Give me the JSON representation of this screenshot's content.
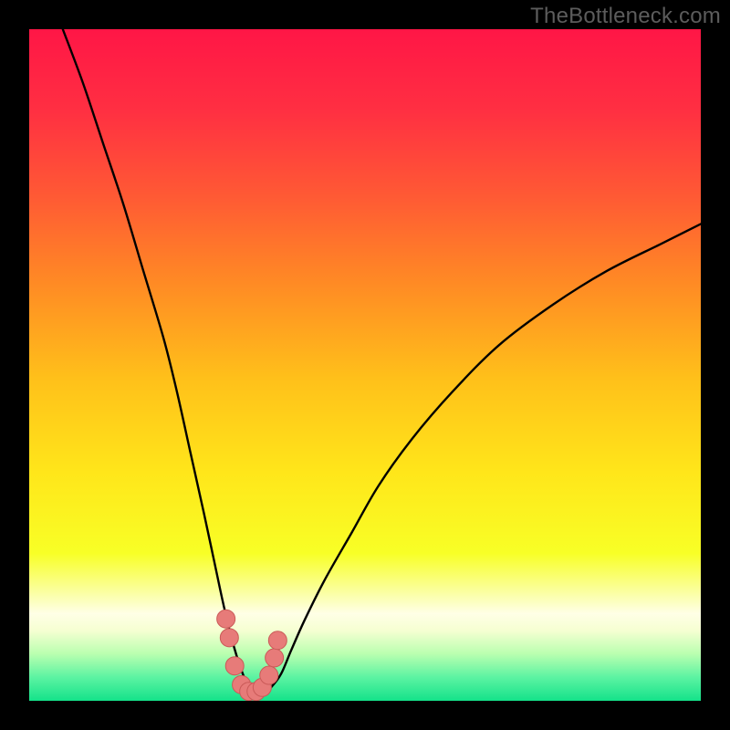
{
  "watermark": {
    "text": "TheBottleneck.com"
  },
  "colors": {
    "frame": "#000000",
    "curve": "#000000",
    "marker_fill": "#e77b79",
    "marker_stroke": "#ca5a58",
    "gradient_stops": [
      {
        "offset": 0.0,
        "color": "#ff1646"
      },
      {
        "offset": 0.12,
        "color": "#ff2f42"
      },
      {
        "offset": 0.25,
        "color": "#ff5a34"
      },
      {
        "offset": 0.38,
        "color": "#ff8b24"
      },
      {
        "offset": 0.52,
        "color": "#ffc01a"
      },
      {
        "offset": 0.66,
        "color": "#ffe61a"
      },
      {
        "offset": 0.78,
        "color": "#f8ff26"
      },
      {
        "offset": 0.845,
        "color": "#fbffb0"
      },
      {
        "offset": 0.87,
        "color": "#ffffe6"
      },
      {
        "offset": 0.895,
        "color": "#f6ffd2"
      },
      {
        "offset": 0.93,
        "color": "#baffb0"
      },
      {
        "offset": 0.965,
        "color": "#5cf3a2"
      },
      {
        "offset": 1.0,
        "color": "#14e28a"
      }
    ]
  },
  "chart_data": {
    "type": "line",
    "title": "",
    "xlabel": "",
    "ylabel": "",
    "xlim": [
      0,
      100
    ],
    "ylim": [
      0,
      100
    ],
    "grid": false,
    "series": [
      {
        "name": "bottleneck-curve",
        "x": [
          5,
          8,
          11,
          14,
          17,
          20,
          22,
          24,
          26,
          27.5,
          29,
          30.5,
          32,
          33,
          34,
          35,
          36,
          37.5,
          39,
          41,
          44,
          48,
          52,
          57,
          63,
          70,
          78,
          86,
          94,
          100
        ],
        "y": [
          100,
          92,
          83,
          74,
          64,
          54,
          46,
          37,
          28,
          21,
          14,
          8,
          3.5,
          1.8,
          1.2,
          1.2,
          2.0,
          4.0,
          7.5,
          12,
          18,
          25,
          32,
          39,
          46,
          53,
          59,
          64,
          68,
          71
        ]
      }
    ],
    "markers": {
      "name": "highlight-points",
      "x": [
        29.3,
        29.8,
        30.6,
        31.6,
        32.7,
        33.8,
        34.7,
        35.7,
        36.5,
        37.0
      ],
      "y": [
        12.2,
        9.4,
        5.2,
        2.4,
        1.4,
        1.4,
        2.0,
        3.8,
        6.4,
        9.0
      ]
    }
  }
}
